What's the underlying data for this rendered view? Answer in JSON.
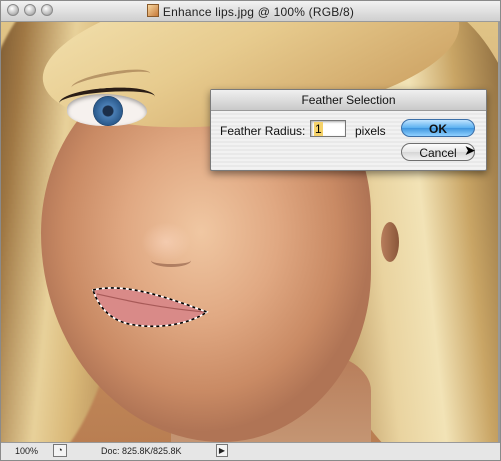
{
  "window": {
    "title": "Enhance lips.jpg @ 100% (RGB/8)"
  },
  "dialog": {
    "title": "Feather Selection",
    "radius_label": "Feather Radius:",
    "radius_value": "1",
    "units_label": "pixels",
    "ok_label": "OK",
    "cancel_label": "Cancel"
  },
  "statusbar": {
    "zoom": "100%",
    "doc_info": "Doc: 825.8K/825.8K"
  },
  "colors": {
    "ok_button": "#5ab0f0",
    "selection_marquee": "#000000",
    "lip_color": "#d98a88"
  },
  "icons": [
    "close-icon",
    "minimize-icon",
    "zoom-icon",
    "document-icon",
    "status-toggle-icon",
    "status-menu-arrow-icon",
    "cursor-arrow-icon"
  ]
}
